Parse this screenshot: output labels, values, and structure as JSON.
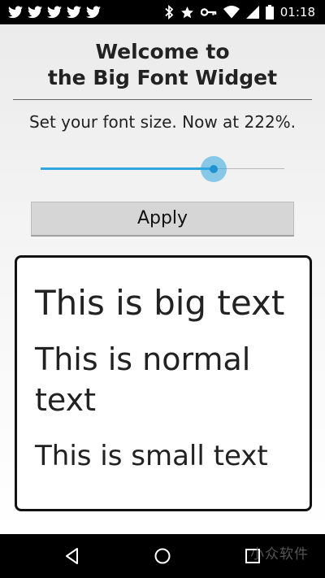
{
  "status_bar": {
    "notification_icons": [
      "twitter-icon",
      "twitter-icon",
      "twitter-icon",
      "twitter-icon",
      "twitter-icon"
    ],
    "system_icons": [
      "bluetooth-icon",
      "star-icon",
      "key-icon",
      "wifi-icon",
      "signal-icon",
      "battery-icon"
    ],
    "time": "01:18"
  },
  "app": {
    "title_line1": "Welcome to",
    "title_line2": "the Big Font Widget",
    "subtitle": "Set your font size. Now at 222%.",
    "slider": {
      "value": 0.71
    },
    "apply_label": "Apply",
    "preview": {
      "big": "This is big text",
      "normal": "This is normal text",
      "small": "This is small text"
    },
    "accent_color": "#2fa6de"
  },
  "nav_bar": {
    "buttons": [
      "back-icon",
      "home-icon",
      "recents-icon"
    ],
    "watermark": "小众软件"
  }
}
